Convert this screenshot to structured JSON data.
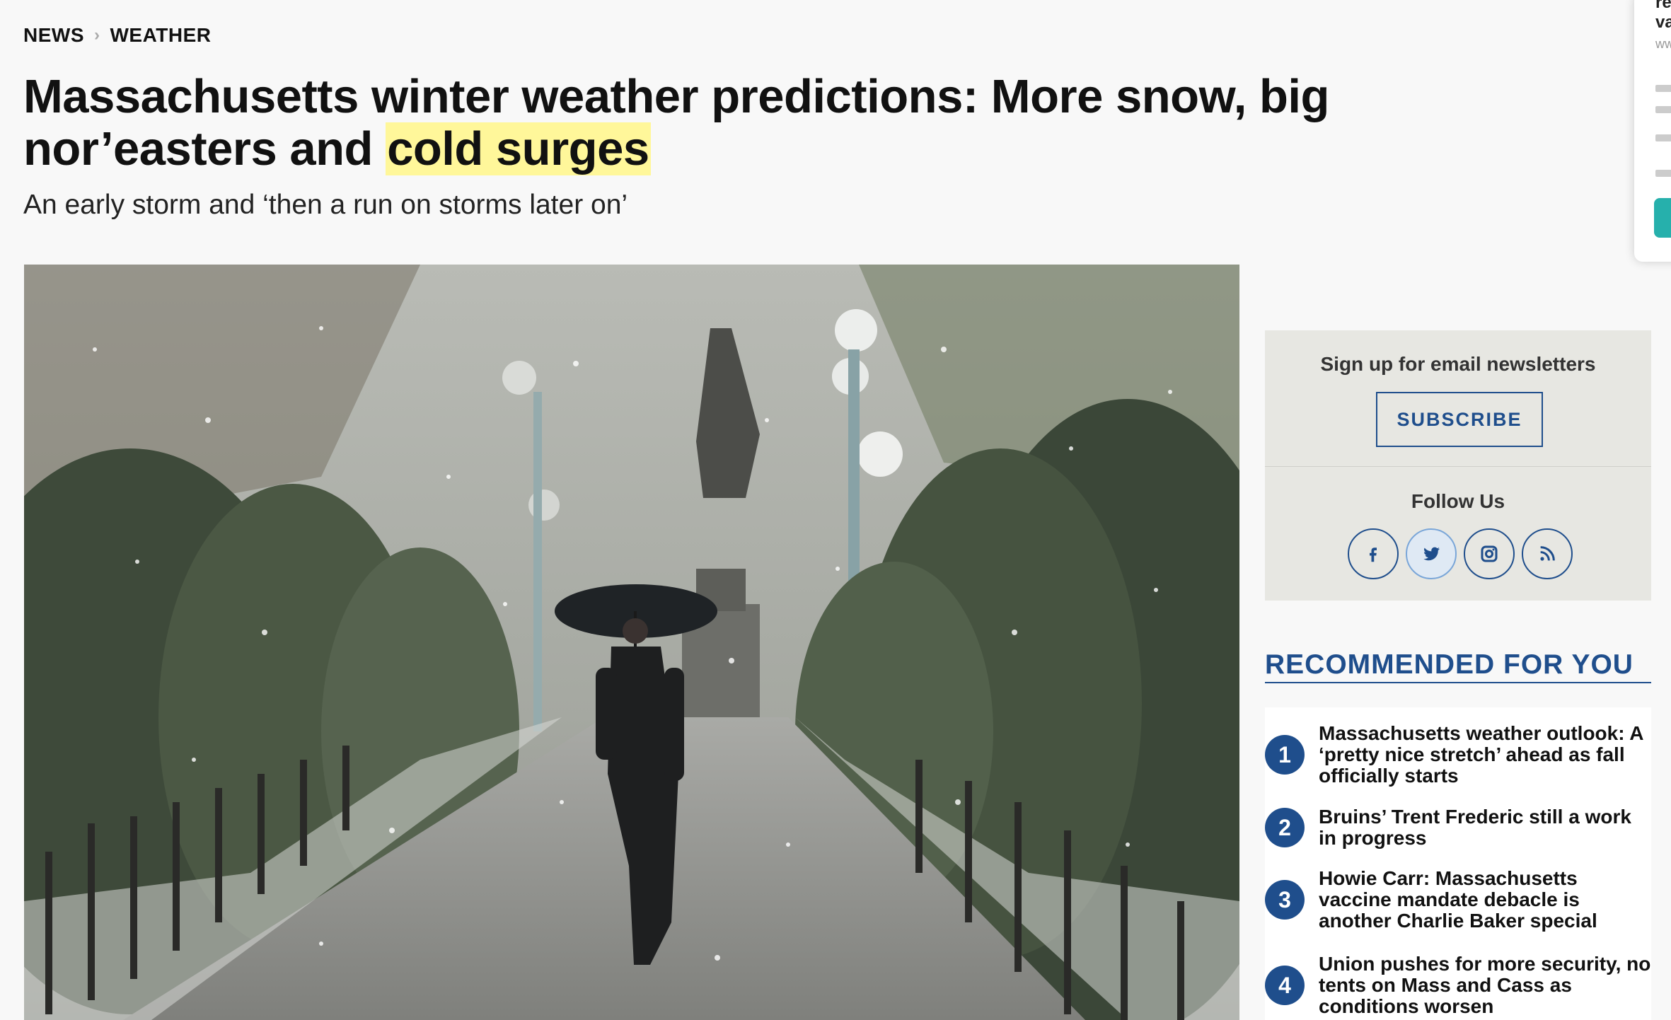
{
  "breadcrumb": {
    "section": "NEWS",
    "subsection": "WEATHER"
  },
  "article": {
    "headline_main": "Massachusetts winter weather predictions: More snow, big nor’easters and",
    "headline_highlight": "cold surges",
    "subhead": "An early storm and ‘then a run on storms later on’",
    "image_description": "Person with umbrella walking on snowy park path"
  },
  "newsletter": {
    "title": "Sign up for email newsletters",
    "subscribe_label": "SUBSCRIBE",
    "follow_title": "Follow Us",
    "socials": [
      "facebook-icon",
      "twitter-icon",
      "instagram-icon",
      "rss-icon"
    ]
  },
  "recommended": {
    "title": "RECOMMENDED FOR YOU",
    "items": [
      {
        "num": "1",
        "text": "Massachusetts weather outlook: A ‘pretty nice stretch’ ahead as fall officially starts"
      },
      {
        "num": "2",
        "text": "Bruins’ Trent Frederic still a work in progress"
      },
      {
        "num": "3",
        "text": "Howie Carr: Massachusetts vaccine mandate debacle is another Charlie Baker special"
      },
      {
        "num": "4",
        "text": "Union pushes for more security, no tents on Mass and Cass as conditions worsen"
      }
    ]
  },
  "popup": {
    "line1": "re",
    "line2": "va",
    "line3": "ww"
  },
  "colors": {
    "accent": "#1f4e8c",
    "highlight": "#fff79a",
    "panel": "#e7e7e2"
  }
}
